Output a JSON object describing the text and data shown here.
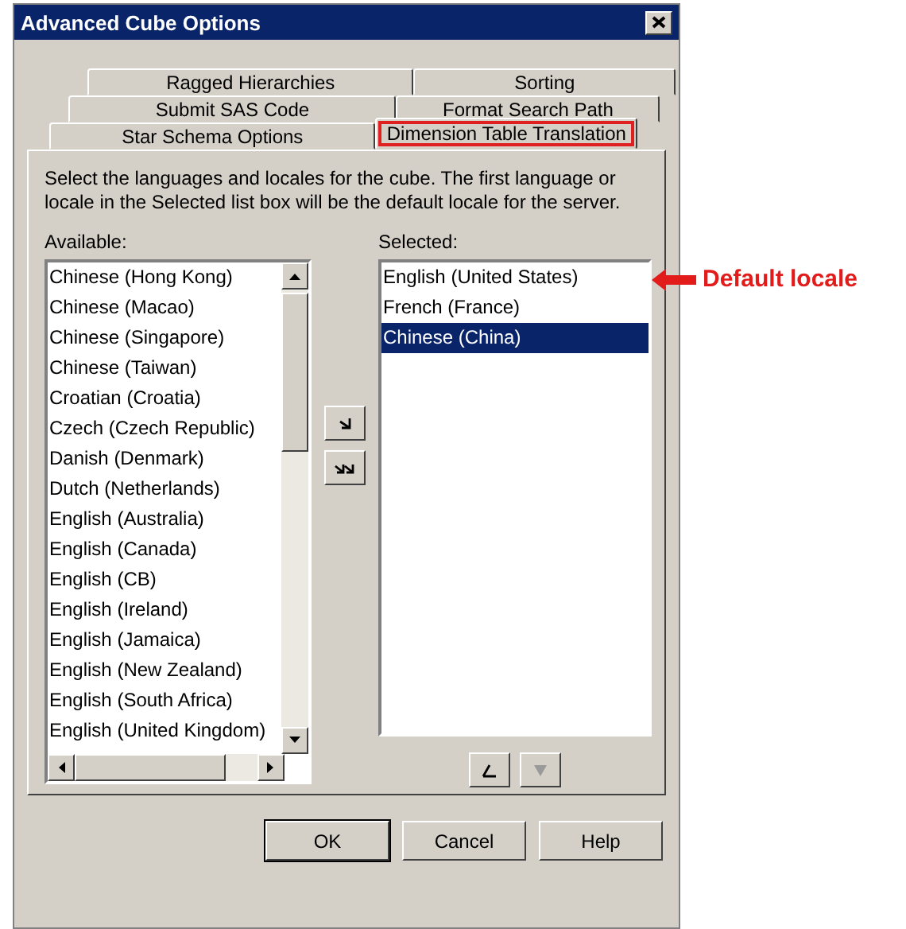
{
  "window": {
    "title": "Advanced Cube Options"
  },
  "tab_rows": [
    [
      {
        "label": "Ragged Hierarchies",
        "selected": false,
        "annotated": false
      },
      {
        "label": "Sorting",
        "selected": false,
        "annotated": false
      }
    ],
    [
      {
        "label": "Submit SAS Code",
        "selected": false,
        "annotated": false
      },
      {
        "label": "Format Search Path",
        "selected": false,
        "annotated": false
      }
    ],
    [
      {
        "label": "Star Schema Options",
        "selected": false,
        "annotated": false
      },
      {
        "label": "Dimension Table Translation",
        "selected": true,
        "annotated": true
      }
    ]
  ],
  "description": "Select the languages and locales for the cube. The first language or locale in the Selected list box will be the default locale for the server.",
  "available": {
    "label": "Available:",
    "items": [
      {
        "label": "Chinese (Hong Kong)",
        "selected": false
      },
      {
        "label": "Chinese (Macao)",
        "selected": false
      },
      {
        "label": "Chinese (Singapore)",
        "selected": false
      },
      {
        "label": "Chinese (Taiwan)",
        "selected": false
      },
      {
        "label": "Croatian (Croatia)",
        "selected": false
      },
      {
        "label": "Czech (Czech Republic)",
        "selected": false
      },
      {
        "label": "Danish (Denmark)",
        "selected": false
      },
      {
        "label": "Dutch (Netherlands)",
        "selected": false
      },
      {
        "label": "English (Australia)",
        "selected": false
      },
      {
        "label": "English (Canada)",
        "selected": false
      },
      {
        "label": "English (CB)",
        "selected": false
      },
      {
        "label": "English (Ireland)",
        "selected": false
      },
      {
        "label": "English (Jamaica)",
        "selected": false
      },
      {
        "label": "English (New Zealand)",
        "selected": false
      },
      {
        "label": "English (South Africa)",
        "selected": false
      },
      {
        "label": "English (United Kingdom)",
        "selected": false
      }
    ]
  },
  "move_buttons": [
    {
      "kind": "add"
    },
    {
      "kind": "add_all"
    }
  ],
  "selected_list": {
    "label": "Selected:",
    "items": [
      {
        "label": "English (United States)",
        "selected": false
      },
      {
        "label": "French (France)",
        "selected": false
      },
      {
        "label": "Chinese (China)",
        "selected": true
      }
    ]
  },
  "order_buttons": [
    {
      "kind": "up",
      "disabled": false
    },
    {
      "kind": "down",
      "disabled": true
    }
  ],
  "buttons": [
    "OK",
    "Cancel",
    "Help"
  ],
  "annotation": {
    "text": "Default locale"
  }
}
